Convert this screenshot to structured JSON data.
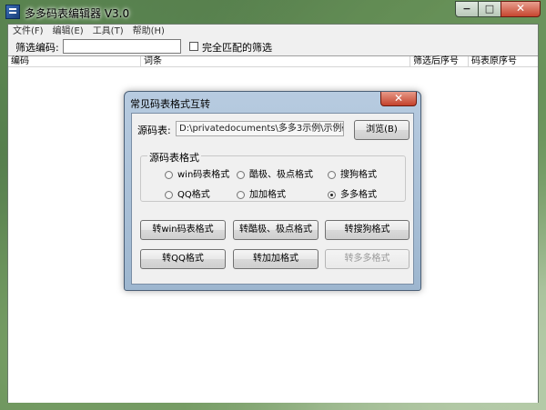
{
  "window": {
    "title": "多多码表编辑器 V3.0",
    "caption": {
      "minimize": "−",
      "maximize": "□",
      "close": "✕"
    }
  },
  "menu": [
    "文件(F)",
    "编辑(E)",
    "工具(T)",
    "帮助(H)"
  ],
  "filter": {
    "label": "筛选编码:",
    "value": "",
    "exact_match_label": "完全匹配的筛选",
    "exact_match_checked": false
  },
  "list": {
    "columns": [
      "编码",
      "词条",
      "筛选后序号",
      "码表原序号"
    ]
  },
  "dialog": {
    "title": "常见码表格式互转",
    "close": "✕",
    "source_label": "源码表:",
    "source_path": "D:\\privatedocuments\\多多3示例\\示例码表.txt",
    "browse_label": "浏览(B)",
    "group_title": "源码表格式",
    "formats": [
      {
        "label": "win码表格式",
        "selected": false
      },
      {
        "label": "酷极、极点格式",
        "selected": false
      },
      {
        "label": "搜狗格式",
        "selected": false
      },
      {
        "label": "QQ格式",
        "selected": false
      },
      {
        "label": "加加格式",
        "selected": false
      },
      {
        "label": "多多格式",
        "selected": true
      }
    ],
    "buttons": [
      {
        "label": "转win码表格式",
        "enabled": true
      },
      {
        "label": "转酷极、极点格式",
        "enabled": true
      },
      {
        "label": "转搜狗格式",
        "enabled": true
      },
      {
        "label": "转QQ格式",
        "enabled": true
      },
      {
        "label": "转加加格式",
        "enabled": true
      },
      {
        "label": "转多多格式",
        "enabled": false
      }
    ]
  }
}
